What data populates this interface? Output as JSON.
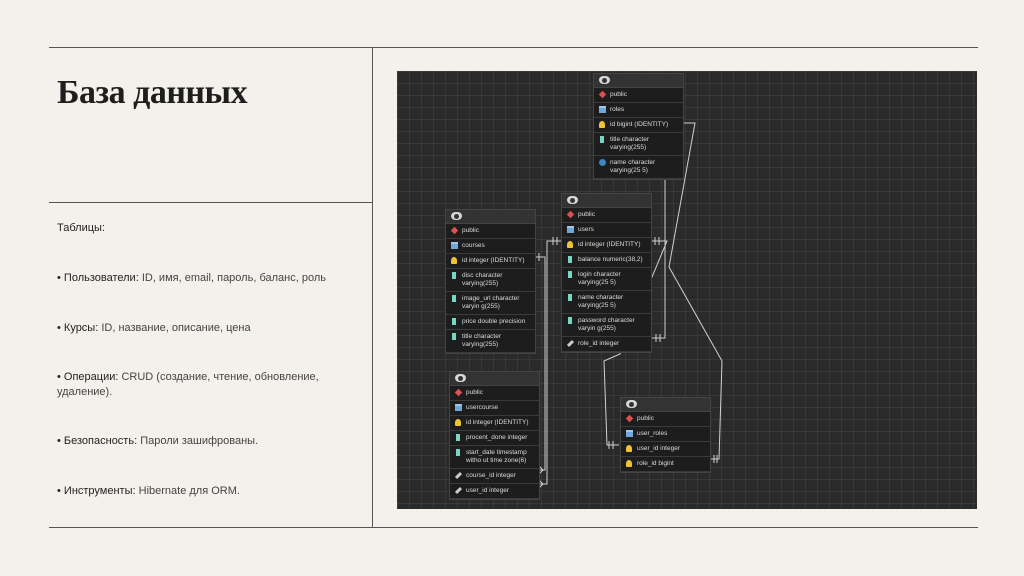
{
  "title": "База данных",
  "intro": "Таблицы:",
  "bullets": [
    {
      "label": "• Пользователи:",
      "value": " ID, имя, email, пароль, баланс, роль"
    },
    {
      "label": "• Курсы:",
      "value": " ID, название, описание, цена"
    },
    {
      "label": "• Операции:",
      "value": " CRUD (создание, чтение, обновление, удаление)."
    },
    {
      "label": "• Безопасность:",
      "value": " Пароли зашифрованы."
    },
    {
      "label": "• Инструменты:",
      "value": " Hibernate для ORM."
    }
  ],
  "diagram": {
    "background": "#2a2a2a",
    "tables": {
      "roles": {
        "schema": "public",
        "name": "roles",
        "columns": [
          {
            "text": "id bigint (IDENTITY)",
            "icon": "key-icon"
          },
          {
            "text": "title character varying(255)",
            "icon": "column-icon"
          },
          {
            "text": "name character varying(25 5)",
            "icon": "unique-icon"
          }
        ]
      },
      "users": {
        "schema": "public",
        "name": "users",
        "columns": [
          {
            "text": "id integer (IDENTITY)",
            "icon": "key-icon"
          },
          {
            "text": "balance numeric(38,2)",
            "icon": "column-icon"
          },
          {
            "text": "login character varying(25 5)",
            "icon": "column-icon"
          },
          {
            "text": "name character varying(25 5)",
            "icon": "column-icon"
          },
          {
            "text": "password character varyin g(255)",
            "icon": "column-icon"
          },
          {
            "text": "role_id integer",
            "icon": "foreign-key-icon"
          }
        ]
      },
      "courses": {
        "schema": "public",
        "name": "courses",
        "columns": [
          {
            "text": "id integer (IDENTITY)",
            "icon": "key-icon"
          },
          {
            "text": "disc character varying(255)",
            "icon": "column-icon"
          },
          {
            "text": "image_url character varyin g(255)",
            "icon": "column-icon"
          },
          {
            "text": "price double precision",
            "icon": "column-icon"
          },
          {
            "text": "title character varying(255)",
            "icon": "column-icon"
          }
        ]
      },
      "usercourse": {
        "schema": "public",
        "name": "usercourse",
        "columns": [
          {
            "text": "id integer (IDENTITY)",
            "icon": "key-icon"
          },
          {
            "text": "procent_done integer",
            "icon": "column-icon"
          },
          {
            "text": "start_date timestamp witho ut time zone(6)",
            "icon": "column-icon"
          },
          {
            "text": "course_id integer",
            "icon": "foreign-key-icon"
          },
          {
            "text": "user_id integer",
            "icon": "foreign-key-icon"
          }
        ]
      },
      "user_roles": {
        "schema": "public",
        "name": "user_roles",
        "columns": [
          {
            "text": "user_id integer",
            "icon": "key-icon"
          },
          {
            "text": "role_id bigint",
            "icon": "key-icon"
          }
        ]
      }
    }
  }
}
